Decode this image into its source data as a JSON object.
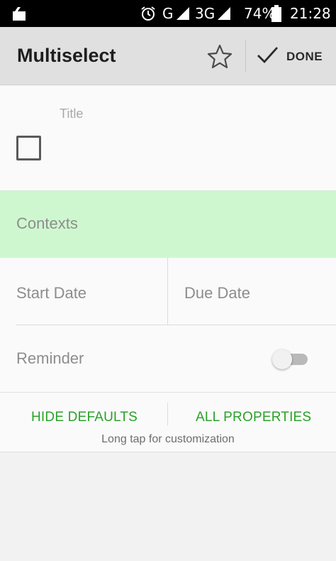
{
  "status_bar": {
    "network_1": "G",
    "network_2": "3G",
    "battery": "74%",
    "time": "21:28",
    "icons": [
      "notification-icon",
      "alarm-icon",
      "signal-icon",
      "battery-icon"
    ]
  },
  "app_bar": {
    "title": "Multiselect",
    "done_label": "DONE",
    "icons": [
      "star-icon",
      "checkmark-icon"
    ]
  },
  "form": {
    "title_placeholder": "Title",
    "contexts_label": "Contexts",
    "start_date_label": "Start Date",
    "due_date_label": "Due Date",
    "reminder_label": "Reminder",
    "reminder_enabled": false,
    "title_checkbox_checked": false
  },
  "actions": {
    "hide_defaults": "HIDE DEFAULTS",
    "all_properties": "ALL PROPERTIES",
    "hint": "Long tap for customization"
  },
  "colors": {
    "accent_green": "#2ba02b",
    "contexts_highlight": "#cff7cf",
    "app_bar": "#e0e0e0"
  }
}
